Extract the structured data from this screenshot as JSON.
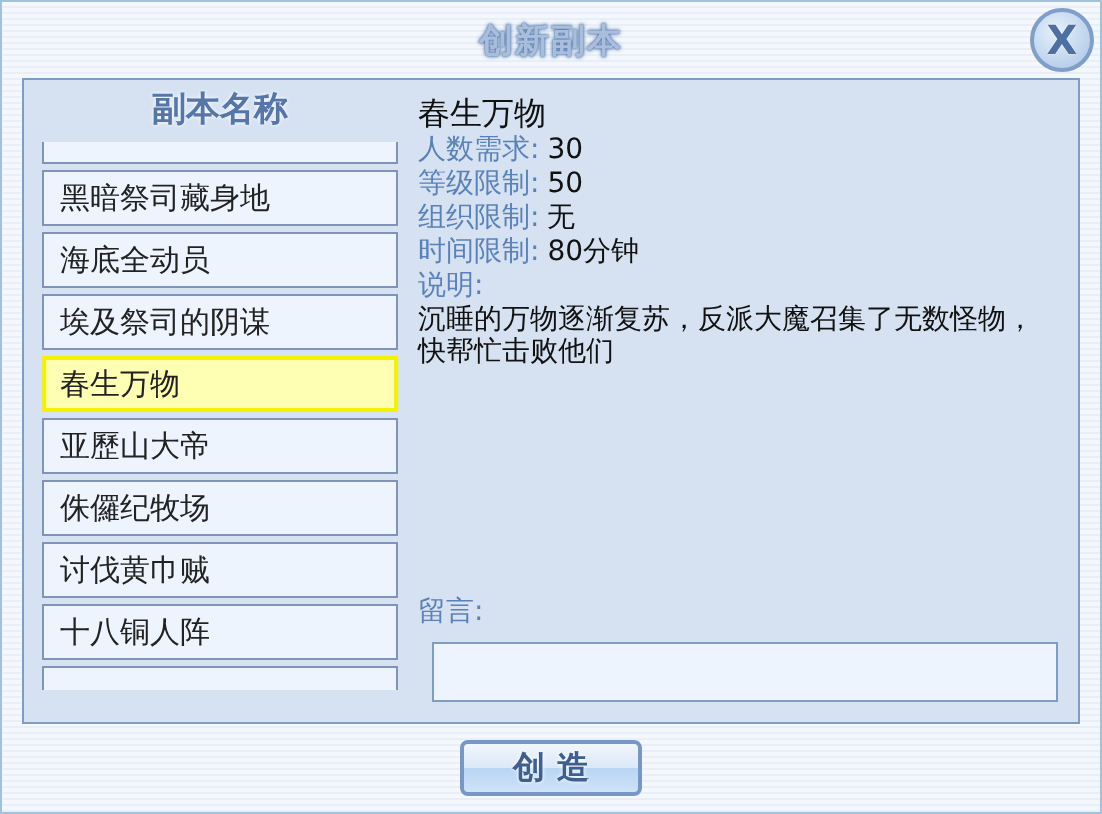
{
  "window": {
    "title": "创新副本",
    "close": "X"
  },
  "list": {
    "heading": "副本名称",
    "items": [
      {
        "label": "黑暗祭司藏身地",
        "selected": false
      },
      {
        "label": "海底全动员",
        "selected": false
      },
      {
        "label": "埃及祭司的阴谋",
        "selected": false
      },
      {
        "label": "春生万物",
        "selected": true
      },
      {
        "label": "亚歷山大帝",
        "selected": false
      },
      {
        "label": "侏儸纪牧场",
        "selected": false
      },
      {
        "label": "讨伐黄巾贼",
        "selected": false
      },
      {
        "label": "十八铜人阵",
        "selected": false
      }
    ]
  },
  "details": {
    "title": "春生万物",
    "fields": [
      {
        "label": "人数需求:",
        "value": "30"
      },
      {
        "label": "等级限制:",
        "value": "50"
      },
      {
        "label": "组织限制:",
        "value": "无"
      },
      {
        "label": "时间限制:",
        "value": "80分钟"
      }
    ],
    "description_label": "说明:",
    "description": "沉睡的万物逐渐复苏，反派大魔召集了无数怪物，快帮忙击败他们"
  },
  "message": {
    "label": "留言:"
  },
  "button": "创 造"
}
